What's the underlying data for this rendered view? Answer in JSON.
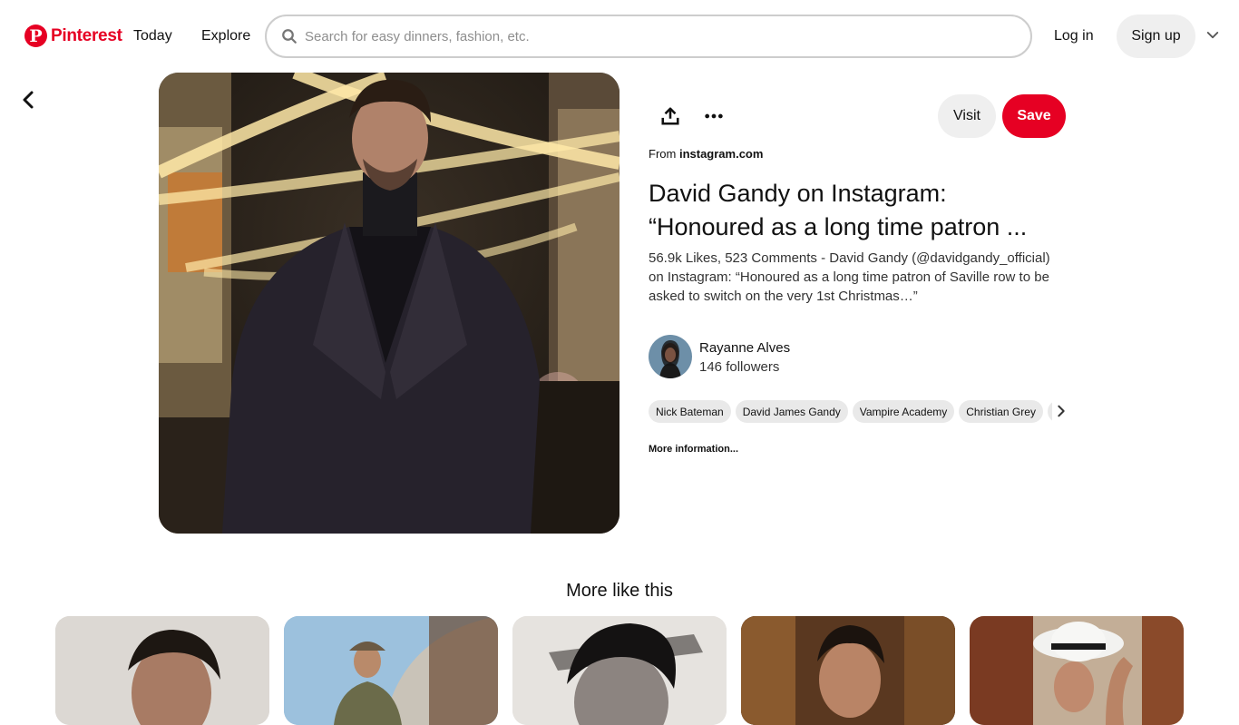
{
  "header": {
    "logo_text": "Pinterest",
    "nav": [
      "Today",
      "Explore"
    ],
    "search_placeholder": "Search for easy dinners, fashion, etc.",
    "login_label": "Log in",
    "signup_label": "Sign up"
  },
  "pin": {
    "visit_label": "Visit",
    "save_label": "Save",
    "from_prefix": "From ",
    "from_domain": "instagram.com",
    "title": "David Gandy on Instagram: “Honoured as a long time patron ...",
    "description": "56.9k Likes, 523 Comments - David Gandy (@davidgandy_official) on Instagram: “Honoured as a long time patron of Saville row to be asked to switch on the very 1st Christmas…”",
    "user": {
      "name": "Rayanne Alves",
      "followers": "146 followers"
    },
    "tags": [
      "Nick Bateman",
      "David James Gandy",
      "Vampire Academy",
      "Christian Grey",
      "C"
    ],
    "more_info_label": "More information..."
  },
  "more_like_this": {
    "heading": "More like this"
  },
  "colors": {
    "brand": "#e60023",
    "pill_gray": "#efefef"
  }
}
